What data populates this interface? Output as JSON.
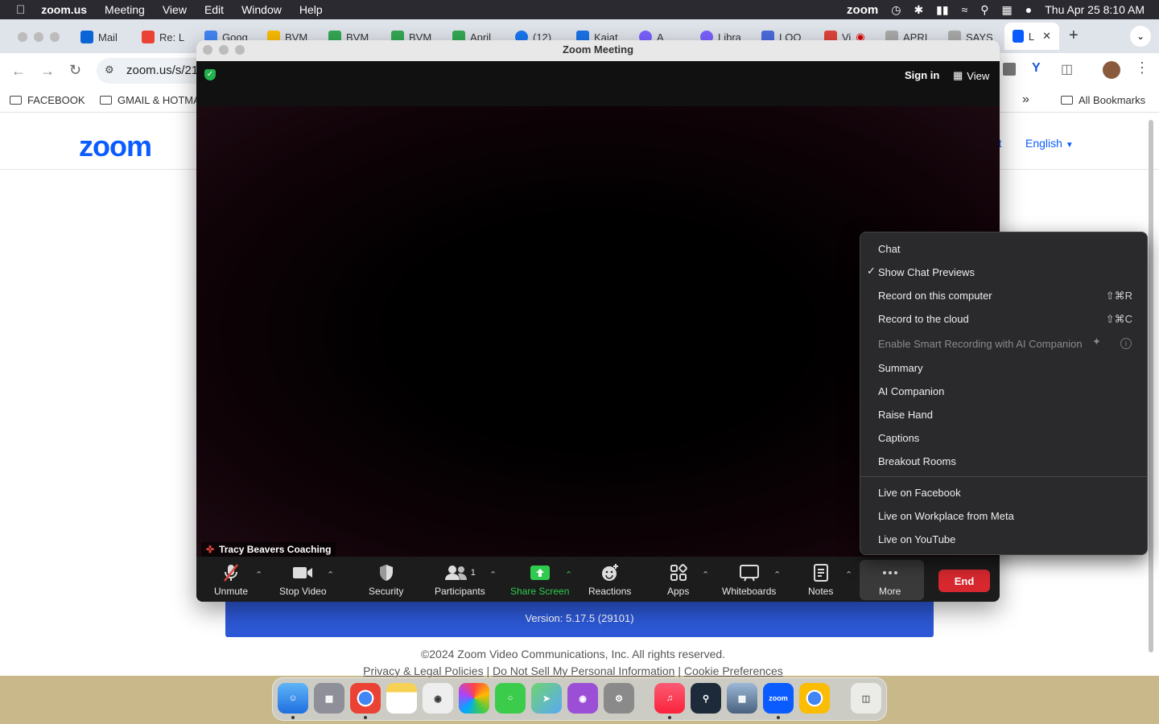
{
  "menubar": {
    "app": "zoom.us",
    "items": [
      "Meeting",
      "View",
      "Edit",
      "Window",
      "Help"
    ],
    "status_zoom": "zoom",
    "clock": "Thu Apr 25  8:10 AM"
  },
  "browser": {
    "tabs": [
      "Mail",
      "Re: L",
      "Goog",
      "BVM",
      "BVM",
      "BVM",
      "April",
      "(12)",
      "Kaiat",
      "A",
      "Libra",
      "LOO",
      "Vi",
      "APRI",
      "SAYS",
      "L"
    ],
    "active_tab": "L",
    "url": "zoom.us/s/21",
    "bookmarks": [
      "FACEBOOK",
      "GMAIL & HOTMA"
    ],
    "all_bookmarks": "All Bookmarks",
    "overflow": "»"
  },
  "page": {
    "logo": "zoom",
    "language": "English",
    "version": "Version: 5.17.5 (29101)",
    "copyright": "©2024 Zoom Video Communications, Inc. All rights reserved.",
    "legal_links": [
      "Privacy & Legal Policies",
      "Do Not Sell My Personal Information",
      "Cookie Preferences"
    ],
    "partial_link": "rt"
  },
  "zoom": {
    "title": "Zoom Meeting",
    "sign_in": "Sign in",
    "view": "View",
    "participant_name": "Tracy Beavers Coaching",
    "toolbar": {
      "unmute": "Unmute",
      "stop_video": "Stop Video",
      "security": "Security",
      "participants": "Participants",
      "participant_count": "1",
      "share_screen": "Share Screen",
      "reactions": "Reactions",
      "apps": "Apps",
      "whiteboards": "Whiteboards",
      "notes": "Notes",
      "more": "More",
      "end": "End"
    },
    "more_menu": {
      "chat": "Chat",
      "show_chat_previews": "Show Chat Previews",
      "record_computer": "Record on this computer",
      "record_computer_shortcut": "⇧⌘R",
      "record_cloud": "Record to the cloud",
      "record_cloud_shortcut": "⇧⌘C",
      "smart_recording": "Enable Smart Recording with AI Companion",
      "summary": "Summary",
      "ai_companion": "AI Companion",
      "raise_hand": "Raise Hand",
      "captions": "Captions",
      "breakout_rooms": "Breakout Rooms",
      "live_facebook": "Live on Facebook",
      "live_workplace": "Live on Workplace from Meta",
      "live_youtube": "Live on YouTube"
    }
  },
  "colors": {
    "zoom_blue": "#0b5cff",
    "share_green": "#2fcb4f",
    "end_red": "#d7282f"
  }
}
